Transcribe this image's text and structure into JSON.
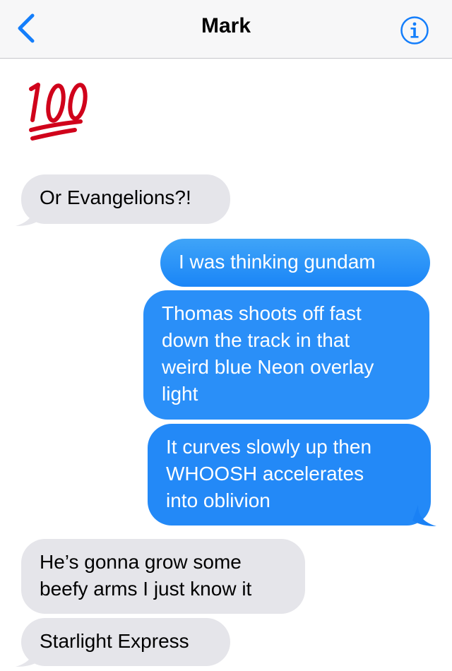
{
  "header": {
    "contact_name": "Mark",
    "back_icon": "chevron-left-icon",
    "info_icon": "info-circle-icon",
    "accent_color": "#147efb"
  },
  "messages": [
    {
      "type": "emoji",
      "direction": "incoming",
      "emoji": "💯"
    },
    {
      "type": "text",
      "direction": "incoming",
      "lines": [
        "Or Evangelions?!"
      ]
    },
    {
      "type": "text",
      "direction": "outgoing",
      "lines": [
        "I was thinking gundam"
      ]
    },
    {
      "type": "text",
      "direction": "outgoing",
      "lines": [
        "Thomas shoots off fast",
        "down the track in that",
        "weird blue Neon overlay",
        "light"
      ]
    },
    {
      "type": "text",
      "direction": "outgoing",
      "lines": [
        "It curves slowly up then",
        "WHOOSH accelerates",
        "into oblivion"
      ]
    },
    {
      "type": "text",
      "direction": "incoming",
      "lines": [
        "He’s gonna grow some",
        "beefy arms I just know it"
      ]
    },
    {
      "type": "text",
      "direction": "incoming",
      "lines": [
        "Starlight Express"
      ]
    }
  ],
  "colors": {
    "incoming_bubble": "#e5e5ea",
    "outgoing_bubble": "#1a85f7",
    "header_background": "#f7f7f8"
  }
}
